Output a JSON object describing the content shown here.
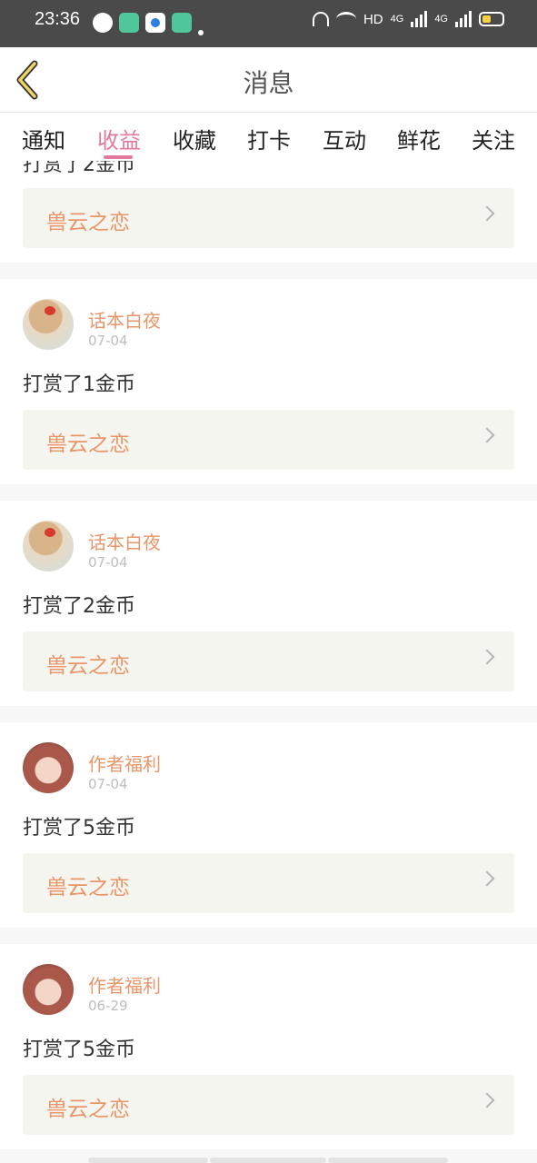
{
  "status_bar": {
    "time": "23:36",
    "network_label": "HD",
    "signal1_label": "4G",
    "signal2_label": "4G"
  },
  "header": {
    "title": "消息",
    "back_icon": "chevron-left-icon"
  },
  "tabs": [
    {
      "label": "通知"
    },
    {
      "label": "收益",
      "active": true
    },
    {
      "label": "收藏"
    },
    {
      "label": "打卡"
    },
    {
      "label": "互动"
    },
    {
      "label": "鲜花"
    },
    {
      "label": "关注"
    }
  ],
  "partial_item": {
    "reward": "打赏了2金币",
    "work_title": "兽云之恋"
  },
  "items": [
    {
      "user": "话本白夜",
      "date": "07-04",
      "reward": "打赏了1金币",
      "work_title": "兽云之恋"
    },
    {
      "user": "话本白夜",
      "date": "07-04",
      "reward": "打赏了2金币",
      "work_title": "兽云之恋"
    },
    {
      "user": "作者福利",
      "date": "07-04",
      "reward": "打赏了5金币",
      "work_title": "兽云之恋"
    },
    {
      "user": "作者福利",
      "date": "06-29",
      "reward": "打赏了5金币",
      "work_title": "兽云之恋"
    }
  ],
  "colors": {
    "accent": "#e4789f",
    "work_title": "#e9956a",
    "work_box_bg": "#f5f5ef",
    "status_bar_bg": "#4a4a4a"
  }
}
